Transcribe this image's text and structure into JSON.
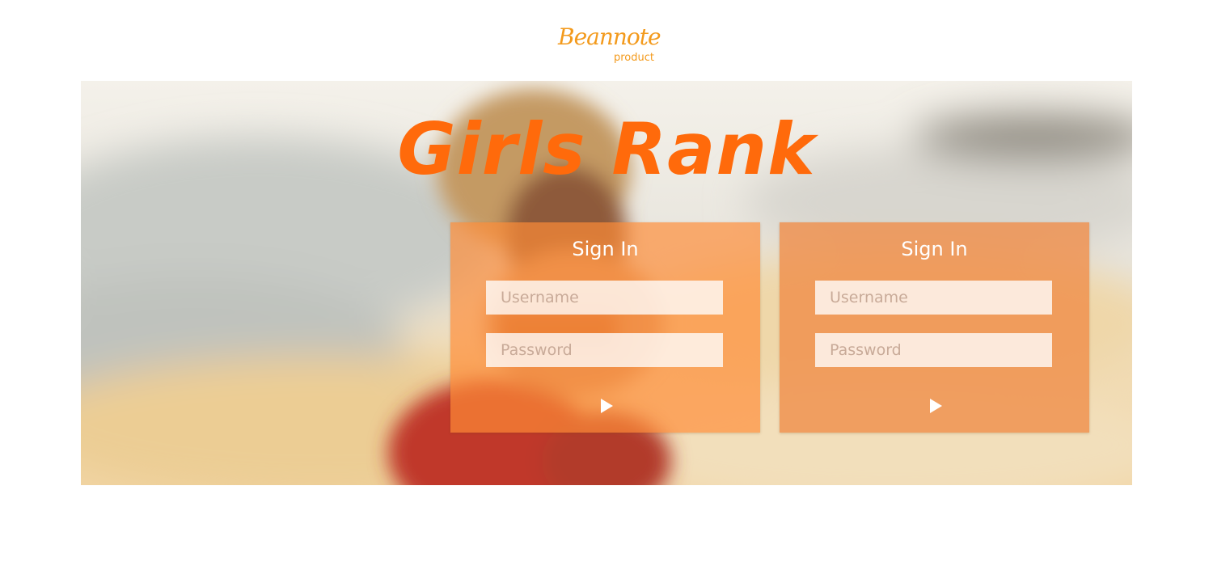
{
  "logo": {
    "script_text": "Beannote",
    "subtext": "product"
  },
  "hero": {
    "title": "Girls Rank"
  },
  "cards": [
    {
      "title": "Sign In",
      "username_placeholder": "Username",
      "password_placeholder": "Password",
      "submit_icon": "play-icon"
    },
    {
      "title": "Sign In",
      "username_placeholder": "Username",
      "password_placeholder": "Password",
      "submit_icon": "play-icon"
    }
  ],
  "colors": {
    "brand": "#f39a1c",
    "title": "#ff6a0b",
    "card_text": "#ffffff"
  }
}
